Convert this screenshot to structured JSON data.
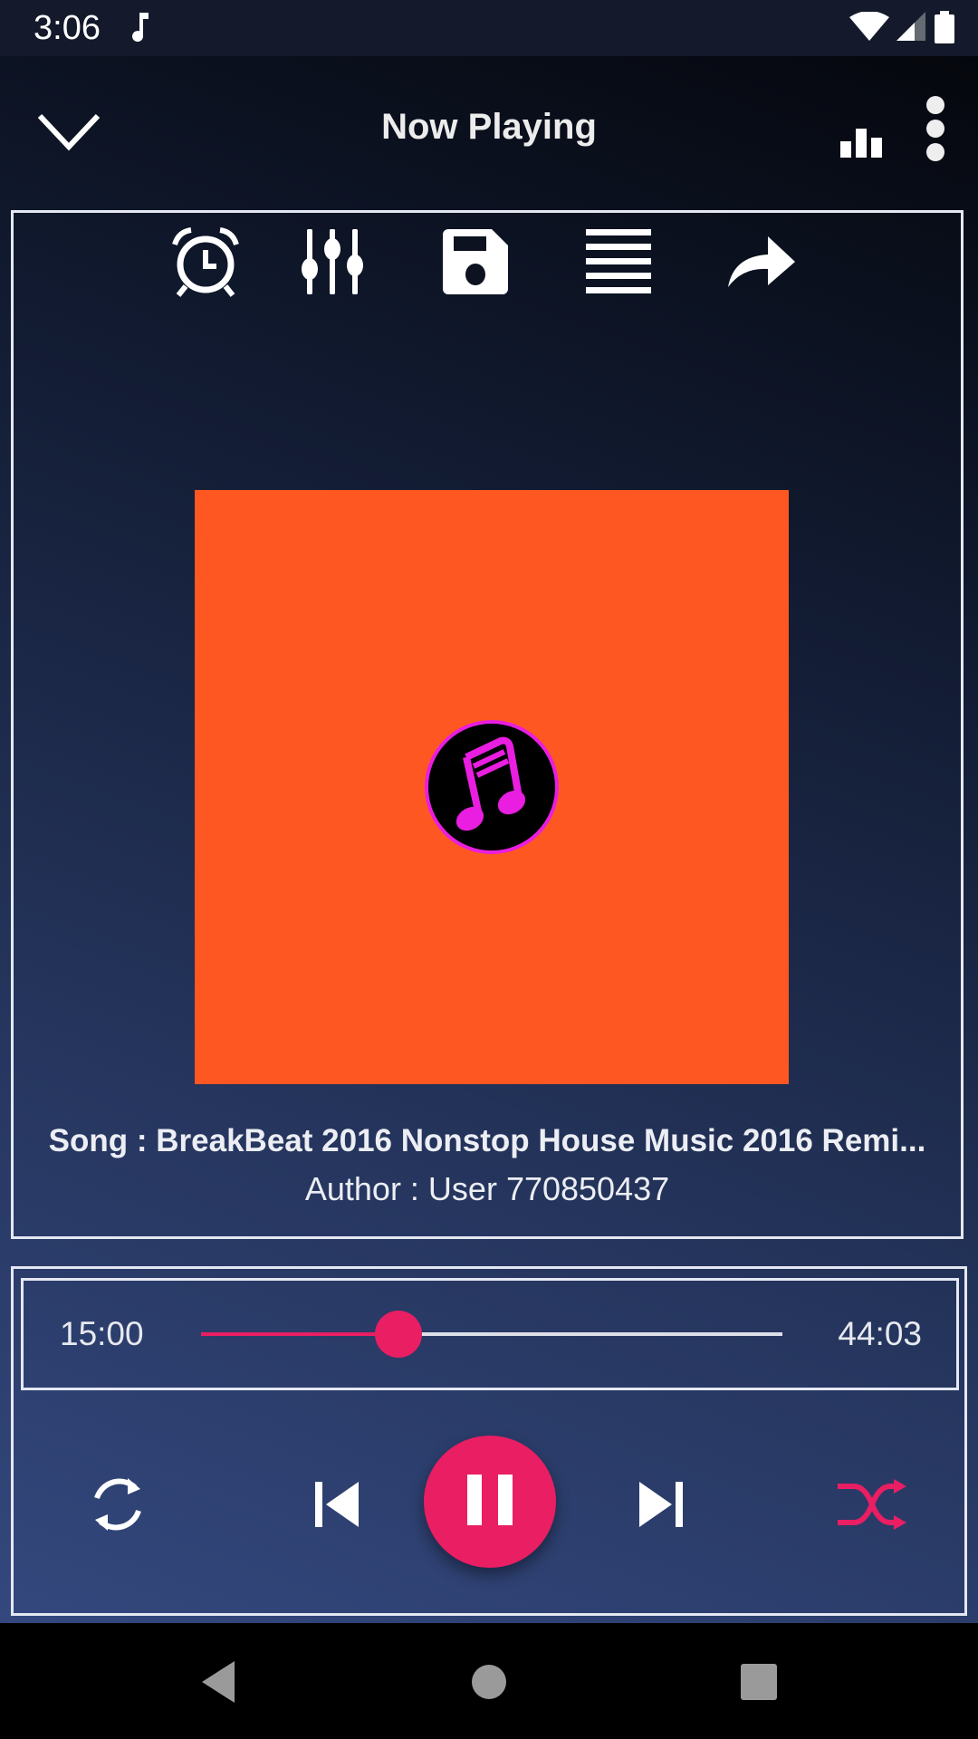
{
  "status_bar": {
    "time": "3:06",
    "icons": [
      "music-note-icon",
      "wifi-icon",
      "signal-icon",
      "battery-icon"
    ]
  },
  "toolbar": {
    "title": "Now Playing",
    "back_icon": "chevron-down-icon",
    "visualizer_icon": "bar-chart-icon",
    "more_icon": "more-vert-icon"
  },
  "actions": [
    {
      "name": "sleep-timer",
      "icon": "alarm-clock-icon"
    },
    {
      "name": "equalizer",
      "icon": "sliders-icon"
    },
    {
      "name": "save",
      "icon": "floppy-disk-icon"
    },
    {
      "name": "queue",
      "icon": "list-icon"
    },
    {
      "name": "share",
      "icon": "share-arrow-icon"
    }
  ],
  "album_art": {
    "background_color": "#ff5722",
    "badge_color": "#e91ee0",
    "icon": "music-notes-icon"
  },
  "track": {
    "song": "Song : BreakBeat 2016 Nonstop House Music 2016 Remi...",
    "author": "Author : User 770850437"
  },
  "seek": {
    "current": "15:00",
    "total": "44:03",
    "progress_fraction": 0.34,
    "accent_color": "#e91e63"
  },
  "controls": {
    "repeat_icon": "repeat-icon",
    "previous_icon": "skip-previous-icon",
    "play_state": "playing",
    "pause_icon": "pause-icon",
    "next_icon": "skip-next-icon",
    "shuffle_icon": "shuffle-icon",
    "shuffle_active": true
  },
  "nav_bar": [
    "back",
    "home",
    "recents"
  ]
}
